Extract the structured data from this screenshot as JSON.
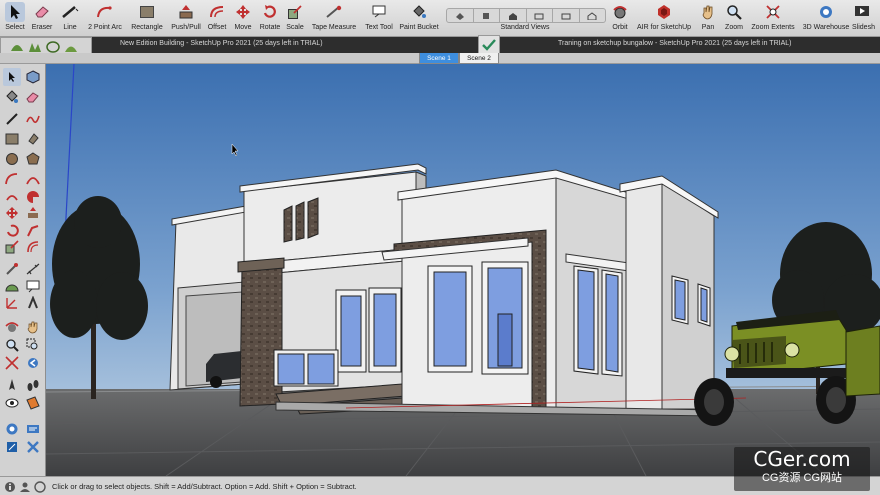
{
  "toolbar": {
    "tools": [
      {
        "label": "Select",
        "icon": "select-arrow-icon"
      },
      {
        "label": "Eraser",
        "icon": "eraser-icon"
      },
      {
        "label": "Line",
        "icon": "pencil-line-icon"
      },
      {
        "label": "2 Point Arc",
        "icon": "arc-icon"
      },
      {
        "label": "Rectangle",
        "icon": "rectangle-icon"
      },
      {
        "label": "Push/Pull",
        "icon": "push-pull-icon"
      },
      {
        "label": "Offset",
        "icon": "offset-icon"
      },
      {
        "label": "Move",
        "icon": "move-icon"
      },
      {
        "label": "Rotate",
        "icon": "rotate-icon"
      },
      {
        "label": "Scale",
        "icon": "scale-icon"
      },
      {
        "label": "Tape Measure",
        "icon": "tape-measure-icon"
      },
      {
        "label": "Text Tool",
        "icon": "text-tool-icon"
      },
      {
        "label": "Paint Bucket",
        "icon": "paint-bucket-icon"
      },
      {
        "label": "Standard Views",
        "icon": "standard-views-icon"
      },
      {
        "label": "Orbit",
        "icon": "orbit-icon"
      },
      {
        "label": "AIR for SketchUp",
        "icon": "air-icon"
      },
      {
        "label": "Pan",
        "icon": "pan-hand-icon"
      },
      {
        "label": "Zoom",
        "icon": "zoom-icon"
      },
      {
        "label": "Zoom Extents",
        "icon": "zoom-extents-icon"
      },
      {
        "label": "3D Warehouse",
        "icon": "warehouse-icon"
      },
      {
        "label": "Slidesh",
        "icon": "slideshow-icon"
      }
    ],
    "accent": "#b9c8dc"
  },
  "titles": {
    "left": "New Edition Building - SketchUp Pro 2021 (25 days left in TRIAL)",
    "right": "Traning on sketchup bungalow - SketchUp Pro 2021 (25 days left in TRIAL)"
  },
  "scenes": [
    {
      "label": "Scene 1",
      "active": true
    },
    {
      "label": "Scene 2",
      "active": false
    }
  ],
  "status": {
    "hint": "Click or drag to select objects. Shift = Add/Subtract. Option = Add. Shift + Option = Subtract."
  },
  "watermark": {
    "line1": "CGer.com",
    "line2": "CG资源 CG网站"
  },
  "colors": {
    "sky_top": "#3f73b3",
    "sky_bottom": "#bcd1e4",
    "ground": "#4d4f52",
    "wall": "#eeeeee",
    "glass": "#7e9ee0",
    "stone": "#5b4e45",
    "jeep": "#7b8f24"
  }
}
